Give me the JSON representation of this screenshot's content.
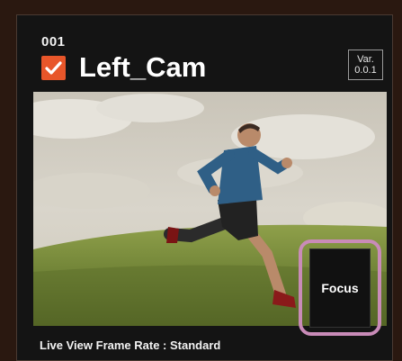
{
  "camera": {
    "number": "001",
    "name": "Left_Cam",
    "checked": true,
    "version_line1": "Var.",
    "version_line2": "0.0.1"
  },
  "preview": {
    "description_icon": "live-view-image"
  },
  "focus_button": {
    "label": "Focus"
  },
  "status": {
    "text": "Live View Frame Rate : Standard"
  },
  "colors": {
    "accent": "#e8562a",
    "highlight_ring": "#c98bb8",
    "panel_bg": "#141414",
    "outer_bg": "#2a1810"
  }
}
